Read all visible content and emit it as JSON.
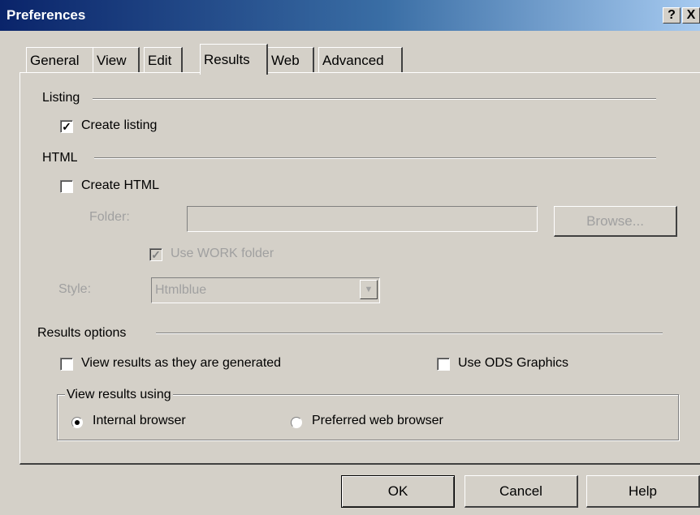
{
  "window": {
    "title": "Preferences",
    "help_button": "?",
    "close_button": "X"
  },
  "tabs": [
    {
      "label": "General"
    },
    {
      "label": "View"
    },
    {
      "label": "Edit"
    },
    {
      "label": "Results",
      "active": true
    },
    {
      "label": "Web"
    },
    {
      "label": "Advanced"
    }
  ],
  "listing": {
    "section_label": "Listing",
    "create_listing_label": "Create listing",
    "create_listing_checked": true
  },
  "html": {
    "section_label": "HTML",
    "create_html_label": "Create HTML",
    "create_html_checked": false,
    "folder_label": "Folder:",
    "folder_value": "",
    "browse_label": "Browse...",
    "use_work_folder_label": "Use WORK folder",
    "use_work_folder_checked": true,
    "style_label": "Style:",
    "style_value": "Htmlblue"
  },
  "results_options": {
    "section_label": "Results options",
    "view_as_generated_label": "View results as they are generated",
    "view_as_generated_checked": false,
    "use_ods_graphics_label": "Use ODS Graphics",
    "use_ods_graphics_checked": false,
    "view_using_group_label": "View results using",
    "internal_browser_label": "Internal browser",
    "preferred_web_browser_label": "Preferred web browser",
    "selected_browser": "Internal browser"
  },
  "buttons": {
    "ok": "OK",
    "cancel": "Cancel",
    "help": "Help"
  }
}
